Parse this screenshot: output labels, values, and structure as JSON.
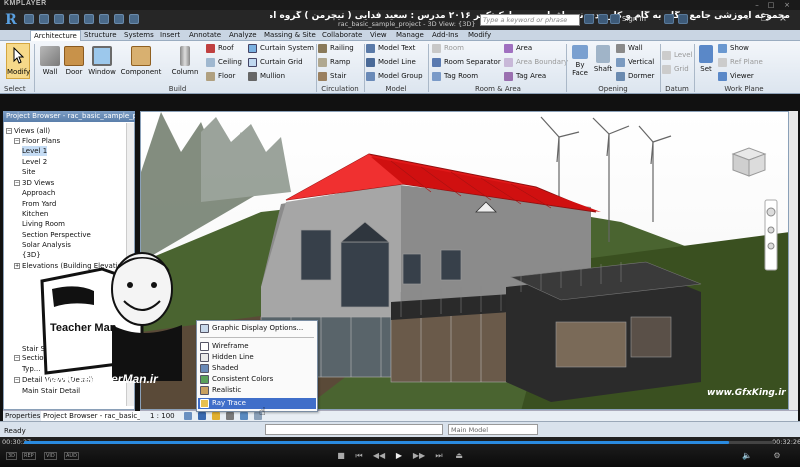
{
  "player": {
    "app_name": "KMPLAYER",
    "time_current": "00:30:27",
    "time_total": "00:32:26",
    "progress_fraction": 0.94
  },
  "window": {
    "title_persian": "مجموعه آموزشی جامع ، گام به گام و کاربردی نرم افزار رویت آرکیتکچر ۲۰۱۶   مدرس : سعید فدایی ( تیچرمن ) گروه آموزشی پادشاه گرافیست ها",
    "file_name": "rac_basic_sample_project - 3D View: {3D}",
    "search_placeholder": "Type a keyword or phrase",
    "sign_in": "Sign In"
  },
  "ribbon": {
    "tabs": [
      "Architecture",
      "Structure",
      "Systems",
      "Insert",
      "Annotate",
      "Analyze",
      "Massing & Site",
      "Collaborate",
      "View",
      "Manage",
      "Add-Ins",
      "Modify"
    ],
    "active_tab": "Architecture",
    "select_label": "Select",
    "modify": "Modify",
    "build": {
      "label": "Build",
      "wall": "Wall",
      "door": "Door",
      "window": "Window",
      "component": "Component",
      "column": "Column",
      "roof": "Roof",
      "ceiling": "Ceiling",
      "floor": "Floor",
      "curtain_system": "Curtain System",
      "curtain_grid": "Curtain Grid",
      "mullion": "Mullion"
    },
    "circulation": {
      "label": "Circulation",
      "railing": "Railing",
      "ramp": "Ramp",
      "stair": "Stair"
    },
    "model": {
      "label": "Model",
      "model_text": "Model Text",
      "model_line": "Model Line",
      "model_group": "Model Group"
    },
    "room_area": {
      "label": "Room & Area",
      "room": "Room",
      "room_separator": "Room Separator",
      "tag_room": "Tag Room",
      "area": "Area",
      "area_boundary": "Area Boundary",
      "tag_area": "Tag Area"
    },
    "opening": {
      "label": "Opening",
      "by_face": "By Face",
      "shaft": "Shaft",
      "wall": "Wall",
      "vertical": "Vertical",
      "dormer": "Dormer"
    },
    "datum": {
      "label": "Datum",
      "level": "Level",
      "grid": "Grid"
    },
    "work_plane": {
      "label": "Work Plane",
      "set": "Set",
      "show": "Show",
      "ref_plane": "Ref Plane",
      "viewer": "Viewer"
    }
  },
  "project_browser": {
    "title": "Project Browser - rac_basic_sample_pr...",
    "items": [
      {
        "text": "Views (all)"
      },
      {
        "text": "Floor Plans"
      },
      {
        "text": "Level 1"
      },
      {
        "text": "Level 2"
      },
      {
        "text": "Site"
      },
      {
        "text": "3D Views"
      },
      {
        "text": "Approach"
      },
      {
        "text": "From Yard"
      },
      {
        "text": "Kitchen"
      },
      {
        "text": "Living Room"
      },
      {
        "text": "Section Perspective"
      },
      {
        "text": "Solar Analysis"
      },
      {
        "text": "{3D}"
      },
      {
        "text": "Elevations (Building Elevation)"
      },
      {
        "text": "Sections (Building Section)"
      },
      {
        "text": "Typ..."
      },
      {
        "text": "Stair Section"
      },
      {
        "text": "Detail Views (Detail)"
      },
      {
        "text": "Main Stair Detail"
      }
    ],
    "tabs": [
      "Properties",
      "Project Browser - rac_basic_..."
    ]
  },
  "popup": {
    "items": [
      "Graphic Display Options...",
      "Wireframe",
      "Hidden Line",
      "Shaded",
      "Consistent Colors",
      "Realistic",
      "Ray Trace"
    ],
    "highlighted": "Ray Trace"
  },
  "view_control": {
    "scale": "1 : 100"
  },
  "status": {
    "ready": "Ready",
    "model": "Main Model"
  },
  "watermarks": {
    "brand_label": "Teacher Man",
    "brand_url": "www.TeacherMan.ir",
    "gfx": "www.GfxKing.ir"
  },
  "colors": {
    "roof": "#e01818",
    "ribbon": "#dce5ef",
    "highlight": "#3f6ec9",
    "accent": "#2a8be0"
  }
}
